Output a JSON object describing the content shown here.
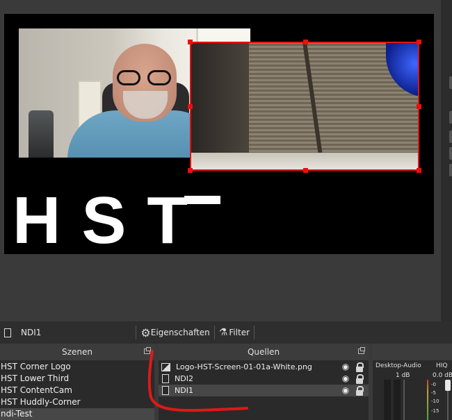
{
  "preview": {
    "logo_text": "HST"
  },
  "toolbar": {
    "source_name": "NDI1",
    "properties_label": "Eigenschaften",
    "filter_label": "Filter"
  },
  "scenes": {
    "title": "Szenen",
    "items": [
      {
        "label": "HST Corner Logo"
      },
      {
        "label": "HST Lower Third"
      },
      {
        "label": "HST ContentCam"
      },
      {
        "label": "HST Huddly-Corner"
      },
      {
        "label": "ndi-Test",
        "selected": true
      }
    ]
  },
  "sources": {
    "title": "Quellen",
    "items": [
      {
        "label": "Logo-HST-Screen-01-01a-White.png",
        "icon": "image-icon"
      },
      {
        "label": "NDI2",
        "icon": "document-icon"
      },
      {
        "label": "NDI1",
        "icon": "document-icon",
        "selected": true
      }
    ]
  },
  "mixer": {
    "channels": [
      {
        "name": "Desktop-Audio",
        "level": "1 dB"
      },
      {
        "name": "HIQ",
        "level": "0.0 dB",
        "scale": [
          "-0",
          "-5",
          "-10",
          "-15"
        ]
      }
    ]
  },
  "colors": {
    "selection": "#e81010",
    "annotation": "#e01818",
    "panel_bg": "#2a2a2a",
    "dock_title_bg": "#3c3c3c"
  }
}
